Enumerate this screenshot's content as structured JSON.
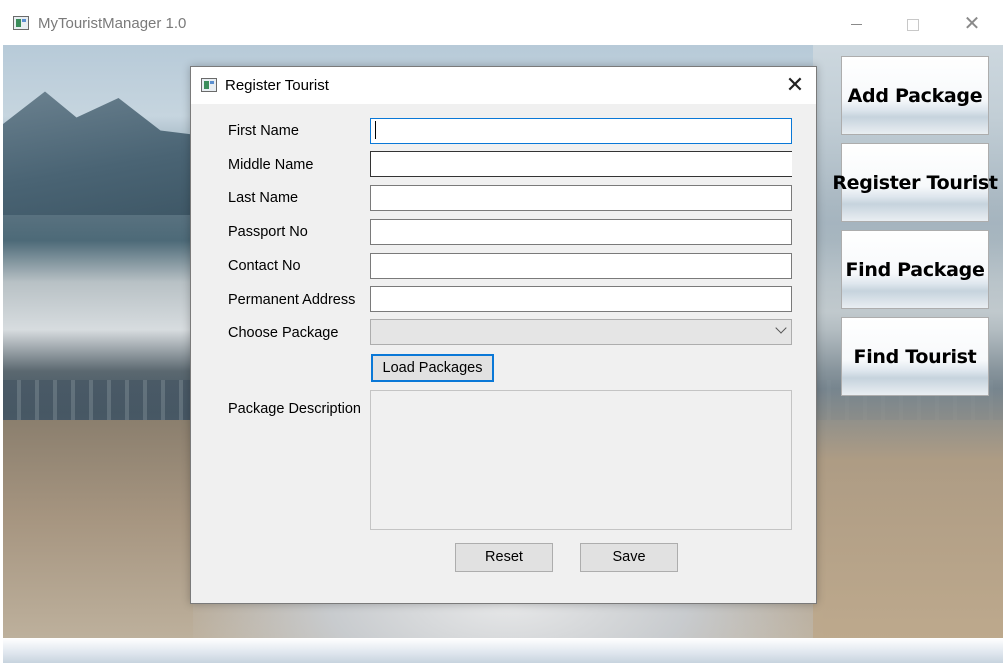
{
  "app": {
    "title": "MyTouristManager 1.0",
    "window_controls": {
      "minimize": "minimize",
      "maximize": "maximize",
      "close": "✕"
    }
  },
  "side_nav": {
    "items": [
      {
        "label": "Add Package"
      },
      {
        "label": "Register Tourist"
      },
      {
        "label": "Find Package"
      },
      {
        "label": "Find Tourist"
      }
    ]
  },
  "dialog": {
    "title": "Register Tourist",
    "close_glyph": "✕",
    "fields": {
      "first_name": {
        "label": "First Name",
        "value": ""
      },
      "middle_name": {
        "label": "Middle Name",
        "value": ""
      },
      "last_name": {
        "label": "Last Name",
        "value": ""
      },
      "passport_no": {
        "label": "Passport No",
        "value": ""
      },
      "contact_no": {
        "label": "Contact No",
        "value": ""
      },
      "permanent_address": {
        "label": "Permanent Address",
        "value": ""
      }
    },
    "choose_package": {
      "label": "Choose Package",
      "selected": ""
    },
    "load_packages_label": "Load Packages",
    "package_description": {
      "label": "Package Description",
      "value": ""
    },
    "reset_label": "Reset",
    "save_label": "Save"
  },
  "colors": {
    "focus_accent": "#0a78d7",
    "dialog_bg": "#f0f0f0",
    "button_bg": "#e1e1e1"
  }
}
